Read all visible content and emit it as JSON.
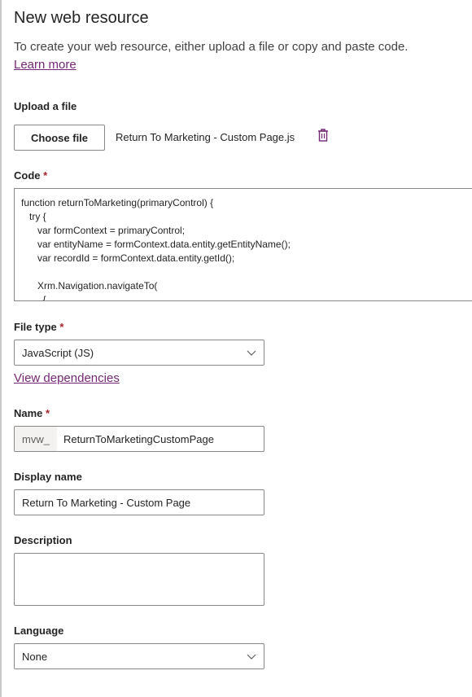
{
  "panel": {
    "title": "New web resource",
    "description": "To create your web resource, either upload a file or copy and paste code.",
    "learn_more": "Learn more"
  },
  "upload": {
    "label": "Upload a file",
    "button": "Choose file",
    "filename": "Return To Marketing - Custom Page.js"
  },
  "code": {
    "label": "Code",
    "required": "*",
    "text": "function returnToMarketing(primaryControl) {\n   try {\n      var formContext = primaryControl;\n      var entityName = formContext.data.entity.getEntityName();\n      var recordId = formContext.data.entity.getId();\n\n      Xrm.Navigation.navigateTo(\n        {"
  },
  "file_type": {
    "label": "File type",
    "required": "*",
    "value": "JavaScript (JS)",
    "view_dependencies": "View dependencies"
  },
  "name": {
    "label": "Name",
    "required": "*",
    "prefix": "mvw_",
    "value": "ReturnToMarketingCustomPage"
  },
  "display_name": {
    "label": "Display name",
    "value": "Return To Marketing - Custom Page"
  },
  "description_field": {
    "label": "Description",
    "value": ""
  },
  "language": {
    "label": "Language",
    "value": "None"
  },
  "colors": {
    "accent": "#742774",
    "required": "#a4262c",
    "border": "#8a8886"
  }
}
